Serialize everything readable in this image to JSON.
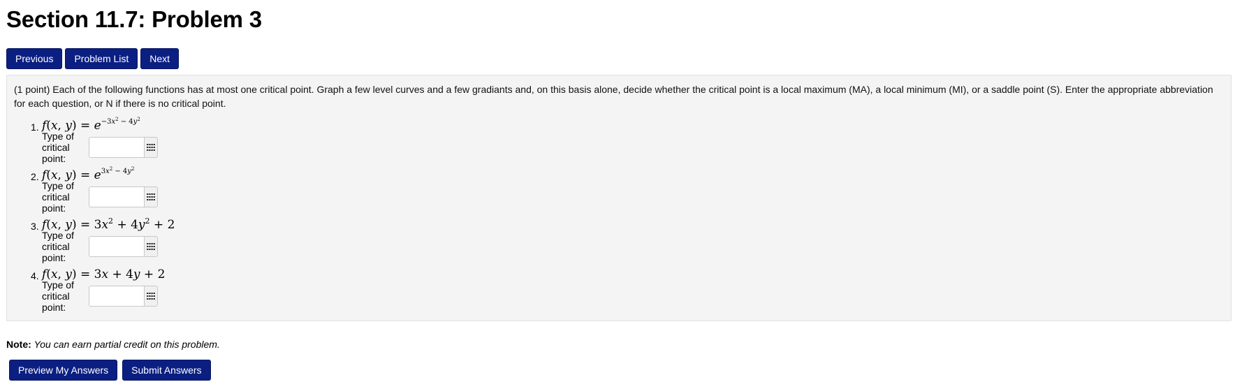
{
  "page": {
    "title": "Section 11.7: Problem 3"
  },
  "nav": {
    "previous_label": "Previous",
    "problem_list_label": "Problem List",
    "next_label": "Next"
  },
  "problem": {
    "intro": "(1 point) Each of the following functions has at most one critical point. Graph a few level curves and a few gradiants and, on this basis alone, decide whether the critical point is a local maximum (MA), a local minimum (MI), or a saddle point (S). Enter the appropriate abbreviation for each question, or N if there is no critical point.",
    "answer_label": "Type of critical point:",
    "answer_button_icon": "grid-icon",
    "questions": [
      {
        "number": "1.",
        "formula": "f(x, y) = e^(−3x² − 4y²)",
        "answer_value": ""
      },
      {
        "number": "2.",
        "formula": "f(x, y) = e^(3x² − 4y²)",
        "answer_value": ""
      },
      {
        "number": "3.",
        "formula": "f(x, y) = 3x² + 4y² + 2",
        "answer_value": ""
      },
      {
        "number": "4.",
        "formula": "f(x, y) = 3x + 4y + 2",
        "answer_value": ""
      }
    ]
  },
  "note": {
    "label": "Note:",
    "text": "You can earn partial credit on this problem."
  },
  "actions": {
    "preview_label": "Preview My Answers",
    "submit_label": "Submit Answers"
  },
  "colors": {
    "button_bg": "#0b1f82",
    "problem_bg": "#f4f4f4"
  }
}
